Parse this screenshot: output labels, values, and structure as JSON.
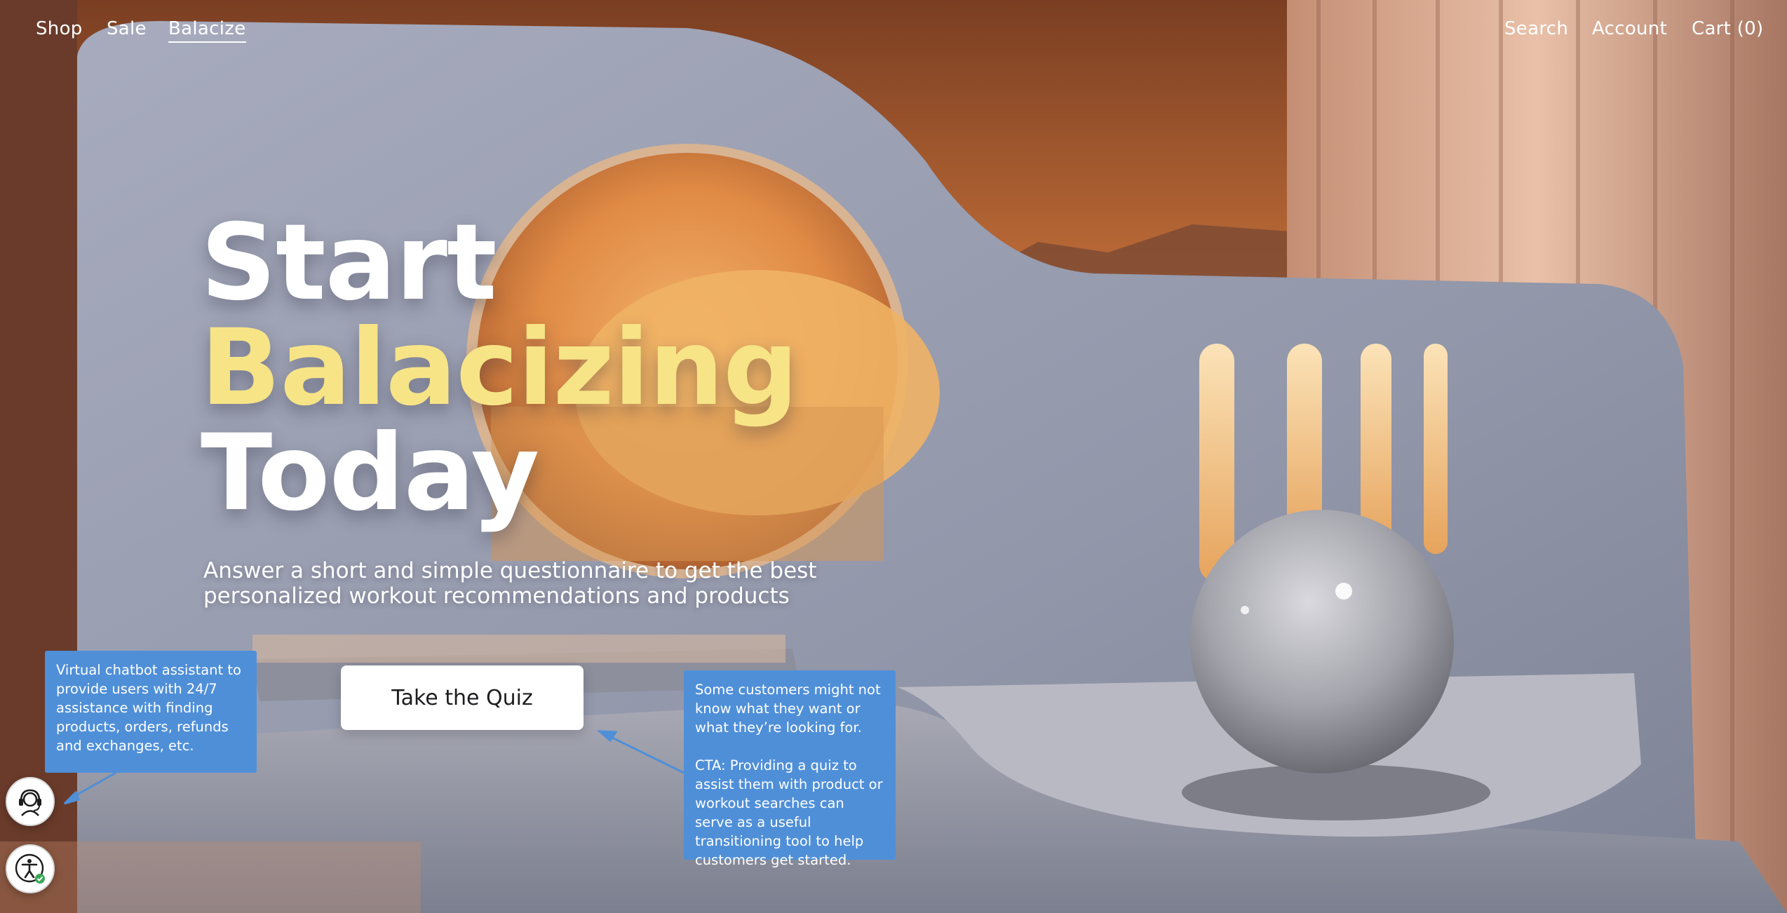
{
  "nav": {
    "left": [
      {
        "label": "Shop"
      },
      {
        "label": "Sale"
      },
      {
        "label": "Balacize"
      }
    ],
    "right": [
      {
        "label": "Search"
      },
      {
        "label": "Account"
      },
      {
        "label": "Cart (0)"
      }
    ]
  },
  "hero": {
    "line1": "Start",
    "line2": "Balacizing",
    "line3": "Today",
    "highlight_color": "#f7e486",
    "subtitle_line1": "Answer a short and simple questionnaire to get the best",
    "subtitle_line2": "personalized workout recommendations and products",
    "cta_label": "Take the Quiz"
  },
  "annotations": {
    "chatbot_note": "Virtual chatbot assistant to provide users with 24/7 assistance with finding products, orders, refunds and exchanges, etc.",
    "quiz_note_p1": "Some customers might not know what they want or what they’re looking for.",
    "quiz_note_p2": "CTA: Providing a quiz to assist them with product or workout searches can serve as a useful transitioning tool to help customers get started.",
    "note_color": "#4f8fd8"
  },
  "widgets": {
    "chat_icon": "headset-agent-icon",
    "accessibility_icon": "accessibility-icon"
  }
}
